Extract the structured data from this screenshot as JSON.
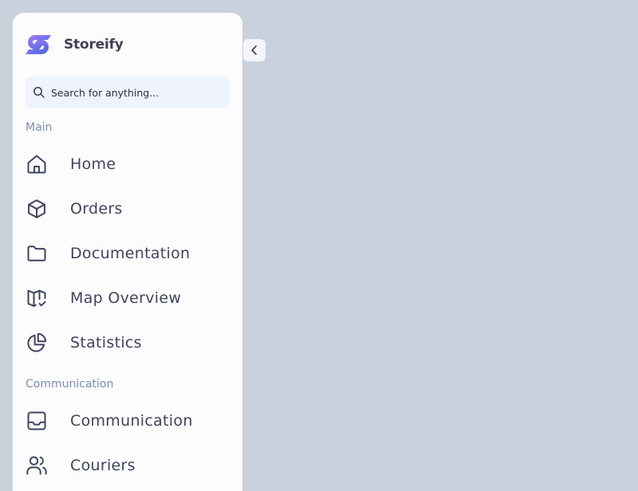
{
  "app": {
    "name": "Storeify"
  },
  "search": {
    "placeholder": "Search for anything..."
  },
  "sections": {
    "main": {
      "label": "Main",
      "items": [
        {
          "label": "Home",
          "icon": "home-icon"
        },
        {
          "label": "Orders",
          "icon": "box-icon"
        },
        {
          "label": "Documentation",
          "icon": "folder-icon"
        },
        {
          "label": "Map Overview",
          "icon": "map-check-icon"
        },
        {
          "label": "Statistics",
          "icon": "pie-chart-icon"
        }
      ]
    },
    "communication": {
      "label": "Communication",
      "items": [
        {
          "label": "Communication",
          "icon": "inbox-icon"
        },
        {
          "label": "Couriers",
          "icon": "users-icon"
        }
      ]
    }
  },
  "colors": {
    "background": "#c9d1dc",
    "sidebar": "#fcfcfd",
    "search_bg": "#eff3fe",
    "text": "#404460",
    "section_label": "#7f8ab0",
    "logo_gradient_start": "#9b7bf5",
    "logo_gradient_end": "#4f63e8"
  },
  "icons": {
    "collapse": "chevron-left-icon",
    "search": "search-icon",
    "logo": "storeify-logo"
  }
}
